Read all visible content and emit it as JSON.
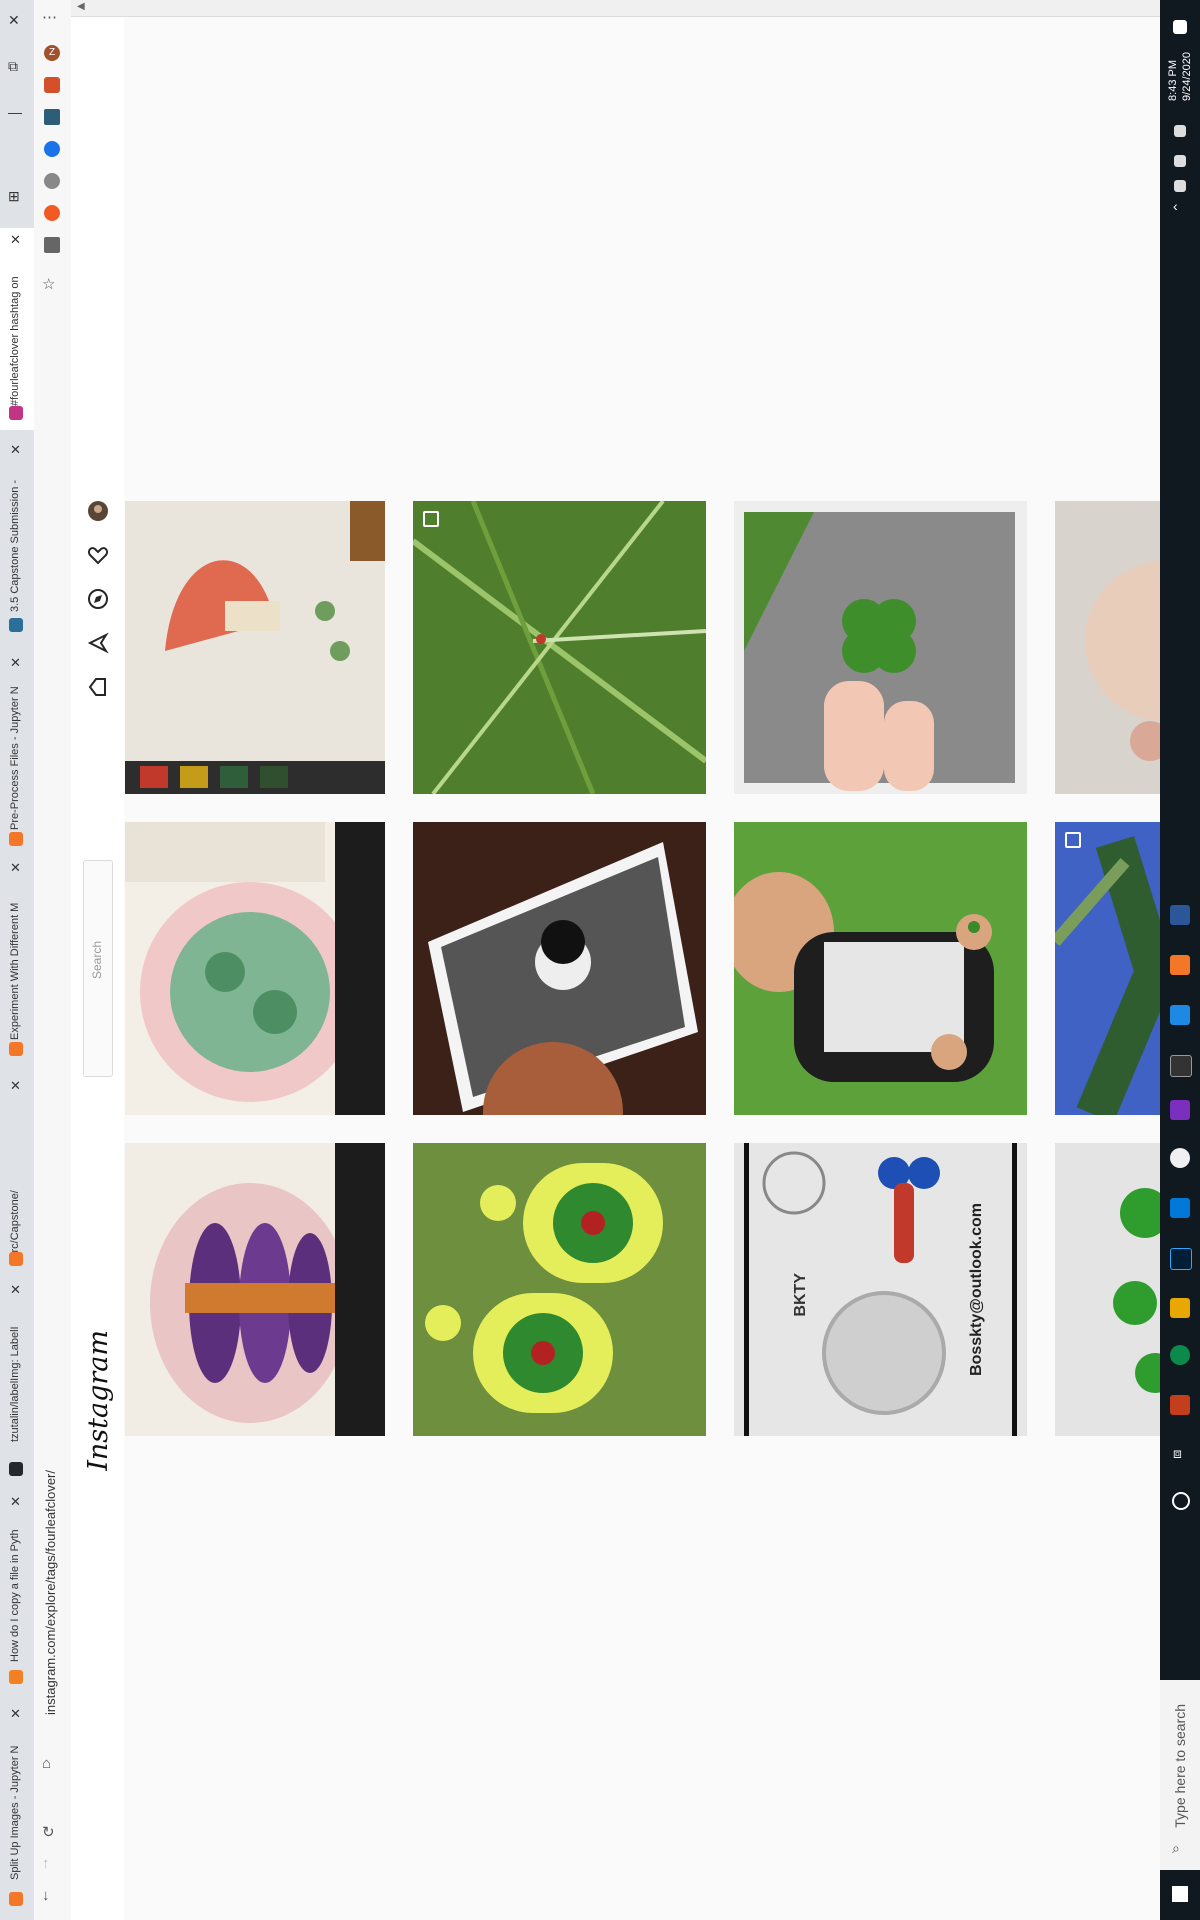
{
  "browser": {
    "tabs": [
      {
        "label": "Split Up Images - Jupyter N",
        "favicon_color": "#f37726"
      },
      {
        "label": "How do I copy a file in Pyth",
        "favicon_color": "#f48024"
      },
      {
        "label": "tzutalin/labelImg: LabelI",
        "favicon_color": "#24292e"
      },
      {
        "label": "src/Capstone/",
        "favicon_color": "#f37726"
      },
      {
        "label": "Experiment With Different M",
        "favicon_color": "#f37726"
      },
      {
        "label": "Pre-Process Files - Jupyter N",
        "favicon_color": "#f37726"
      },
      {
        "label": "3.5 Capstone Submission - ",
        "favicon_color": "#2a6f97"
      },
      {
        "label": "#fourleafclover hashtag on",
        "favicon_color": "#c13584"
      }
    ],
    "url": "instagram.com/explore/tags/fourleafclover/",
    "profile_initial": "Z",
    "window_controls": [
      "✕",
      "⧉",
      "—",
      "⊞"
    ]
  },
  "instagram": {
    "logo": "Instagram",
    "search_placeholder": "Search"
  },
  "grid": {
    "rows": [
      [
        "mushroom-watercolor",
        "grass-ladybug",
        "four-leaf-clover-hand",
        "baby-photo"
      ],
      [
        "japanese-clover-painting",
        "ink-leaves-portrait",
        "boy-holding-clover",
        "palm-tree-sky"
      ],
      [
        "eggplant-painting",
        "ladybug-clay-earrings",
        "resin-keychain",
        "green-shamrock-pieces"
      ]
    ],
    "keychain_text": {
      "brand": "BKTY",
      "email": "Bosskty@outlook.com"
    }
  },
  "taskbar": {
    "time": "8:43 PM",
    "date": "9/24/2020",
    "search_placeholder": "Type here to search"
  }
}
